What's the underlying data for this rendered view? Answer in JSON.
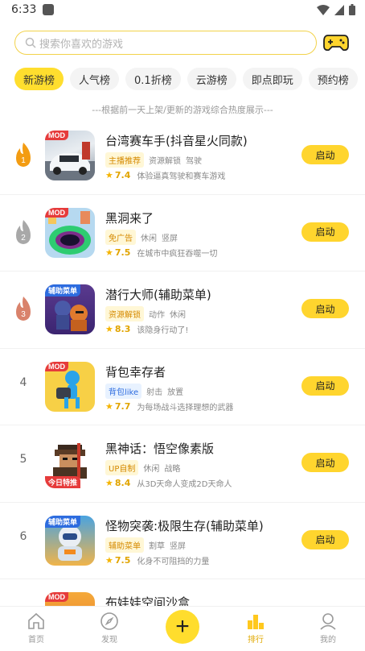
{
  "status_bar": {
    "time": "6:33"
  },
  "search": {
    "placeholder": "搜索你喜欢的游戏"
  },
  "tabs": [
    {
      "label": "新游榜",
      "active": true
    },
    {
      "label": "人气榜"
    },
    {
      "label": "0.1折榜"
    },
    {
      "label": "云游榜"
    },
    {
      "label": "即点即玩"
    },
    {
      "label": "预约榜"
    }
  ],
  "subtitle": "---根据前一天上架/更新的游戏综合热度展示---",
  "games": [
    {
      "rank": "1",
      "icon_tag": "MOD",
      "name": "台湾赛车手(抖音星火同款)",
      "chip": "主播推荐",
      "tags": [
        "资源解锁",
        "驾驶"
      ],
      "score": "7.4",
      "desc": "体验逼真驾驶和赛车游戏",
      "button": "启动"
    },
    {
      "rank": "2",
      "icon_tag": "MOD",
      "name": "黑洞来了",
      "chip": "免广告",
      "tags": [
        "休闲",
        "竖屏"
      ],
      "score": "7.5",
      "desc": "在城市中疯狂吞噬一切",
      "button": "启动"
    },
    {
      "rank": "3",
      "icon_tag": "辅助菜单",
      "name": "潜行大师(辅助菜单)",
      "chip": "资源解锁",
      "tags": [
        "动作",
        "休闲"
      ],
      "score": "8.3",
      "desc": "该隐身行动了!",
      "button": "启动"
    },
    {
      "rank": "4",
      "icon_tag": "MOD",
      "name": "背包幸存者",
      "chip": "背包like",
      "tags": [
        "射击",
        "放置"
      ],
      "score": "7.7",
      "desc": "为每场战斗选择理想的武器",
      "button": "启动"
    },
    {
      "rank": "5",
      "icon_tag": "今日特推",
      "name": "黑神话：悟空像素版",
      "chip": "UP自制",
      "tags": [
        "休闲",
        "战略"
      ],
      "score": "8.4",
      "desc": "从3D天命人变成2D天命人",
      "button": "启动"
    },
    {
      "rank": "6",
      "icon_tag": "辅助菜单",
      "name": "怪物突袭:极限生存(辅助菜单)",
      "chip": "辅助菜单",
      "tags": [
        "割草",
        "竖屏"
      ],
      "score": "7.5",
      "desc": "化身不可阻挡的力量",
      "button": "启动"
    },
    {
      "rank": "",
      "icon_tag": "MOD",
      "name": "布娃娃空间沙盒",
      "chip": "",
      "tags": [],
      "score": "",
      "desc": "",
      "button": ""
    }
  ],
  "bottom_nav": [
    {
      "label": "首页",
      "icon": "home-icon"
    },
    {
      "label": "发现",
      "icon": "compass-icon"
    },
    {
      "label": "排行",
      "icon": "ranking-icon",
      "active": true
    },
    {
      "label": "我的",
      "icon": "profile-icon"
    }
  ],
  "colors": {
    "accent": "#ffd52e",
    "rank_gold": "#f39c12",
    "rank_silver": "#a8a8a8",
    "rank_bronze": "#d9826b"
  }
}
